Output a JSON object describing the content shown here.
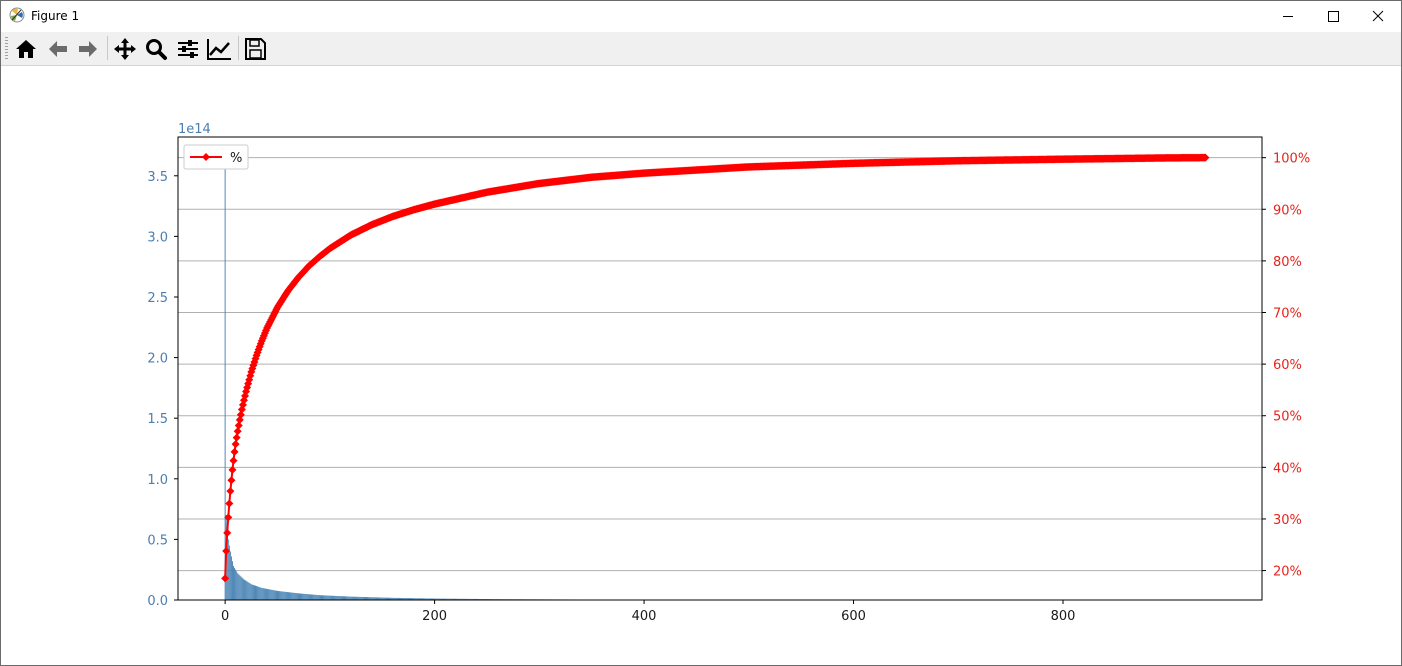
{
  "window": {
    "title": "Figure 1"
  },
  "toolbar": {
    "buttons": [
      {
        "name": "home-button",
        "icon": "home-icon"
      },
      {
        "name": "back-button",
        "icon": "arrow-left-icon"
      },
      {
        "name": "forward-button",
        "icon": "arrow-right-icon"
      },
      {
        "name": "pan-button",
        "icon": "move-icon"
      },
      {
        "name": "zoom-button",
        "icon": "magnifier-icon"
      },
      {
        "name": "subplots-button",
        "icon": "sliders-icon"
      },
      {
        "name": "axes-edit-button",
        "icon": "line-chart-icon"
      },
      {
        "name": "save-button",
        "icon": "floppy-disk-icon"
      }
    ]
  },
  "chart_data": {
    "type": "bar",
    "title": "",
    "xlabel": "",
    "ylabel": "",
    "left_axis": {
      "offset_label": "1e14",
      "ylim": [
        0,
        3.82
      ],
      "ticks": [
        "0.0",
        "0.5",
        "1.0",
        "1.5",
        "2.0",
        "2.5",
        "3.0",
        "3.5"
      ],
      "color": "#4a7fb0"
    },
    "right_axis": {
      "ylim": [
        14.3,
        104.0
      ],
      "ticks": [
        "20%",
        "30%",
        "40%",
        "50%",
        "60%",
        "70%",
        "80%",
        "90%",
        "100%"
      ],
      "color": "#e8231c",
      "grid": true
    },
    "x_axis": {
      "xlim": [
        -45,
        990
      ],
      "ticks": [
        "0",
        "200",
        "400",
        "600",
        "800"
      ]
    },
    "bar_color": "#4682b4",
    "bars": {
      "count": 937,
      "sample_values_1e14": [
        [
          0,
          3.6
        ],
        [
          1,
          0.7
        ],
        [
          2,
          0.55
        ],
        [
          5,
          0.4
        ],
        [
          8,
          0.28
        ],
        [
          12,
          0.22
        ],
        [
          18,
          0.17
        ],
        [
          25,
          0.13
        ],
        [
          35,
          0.1
        ],
        [
          50,
          0.075
        ],
        [
          70,
          0.055
        ],
        [
          90,
          0.04
        ],
        [
          120,
          0.028
        ],
        [
          160,
          0.018
        ],
        [
          200,
          0.012
        ],
        [
          260,
          0.007
        ],
        [
          340,
          0.004
        ],
        [
          450,
          0.0015
        ],
        [
          600,
          0.0005
        ],
        [
          936,
          0.0
        ]
      ]
    },
    "series": [
      {
        "name": "%",
        "type": "line",
        "axis": "right",
        "color": "#ff0000",
        "marker": "diamond",
        "x": [
          0,
          1,
          2,
          3,
          4,
          5,
          6,
          7,
          8,
          9,
          10,
          12,
          14,
          16,
          18,
          20,
          25,
          30,
          35,
          40,
          50,
          60,
          70,
          80,
          90,
          100,
          120,
          140,
          160,
          180,
          200,
          250,
          300,
          350,
          400,
          500,
          600,
          700,
          800,
          900,
          936
        ],
        "values": [
          18.5,
          23.8,
          27.3,
          30.3,
          33.0,
          35.4,
          37.5,
          39.5,
          41.3,
          43.0,
          44.5,
          47.0,
          49.2,
          51.2,
          53.0,
          54.7,
          58.5,
          61.7,
          64.5,
          67.0,
          71.0,
          74.2,
          76.8,
          79.0,
          80.8,
          82.4,
          85.0,
          87.0,
          88.6,
          89.9,
          91.0,
          93.3,
          95.0,
          96.2,
          97.0,
          98.2,
          98.9,
          99.4,
          99.7,
          99.95,
          100.0
        ]
      }
    ],
    "legend": {
      "position": "top-left",
      "labels": [
        "%"
      ]
    }
  }
}
